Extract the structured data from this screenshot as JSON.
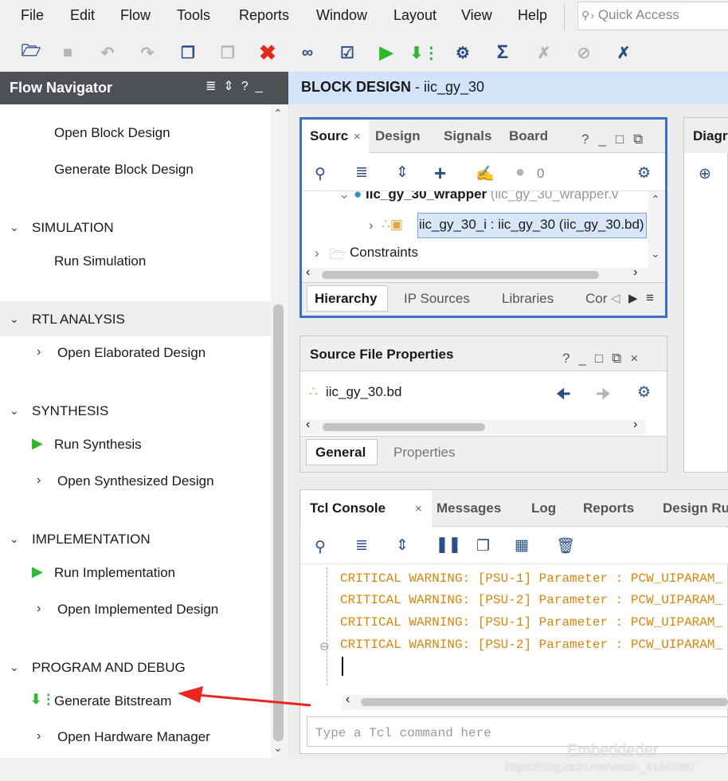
{
  "menu": [
    "File",
    "Edit",
    "Flow",
    "Tools",
    "Reports",
    "Window",
    "Layout",
    "View",
    "Help"
  ],
  "quick_access": {
    "placeholder": "Quick Access",
    "icon": "search-icon"
  },
  "toolbar_icons": [
    "open-project-icon",
    "save-icon",
    "undo-icon",
    "redo-icon",
    "copy-icon",
    "paste-icon",
    "delete-icon",
    "binoculars-icon",
    "checkbox-icon",
    "run-icon",
    "bitstream-icon",
    "settings-icon",
    "sigma-icon",
    "debug-icon",
    "probe-icon",
    "tools-icon"
  ],
  "flow_navigator": {
    "title": "Flow Navigator",
    "items": {
      "open_block_design": "Open Block Design",
      "generate_block_design": "Generate Block Design",
      "simulation": "SIMULATION",
      "run_simulation": "Run Simulation",
      "rtl_analysis": "RTL ANALYSIS",
      "open_elaborated": "Open Elaborated Design",
      "synthesis": "SYNTHESIS",
      "run_synthesis": "Run Synthesis",
      "open_synthesized": "Open Synthesized Design",
      "implementation": "IMPLEMENTATION",
      "run_implementation": "Run Implementation",
      "open_implemented": "Open Implemented Design",
      "program_debug": "PROGRAM AND DEBUG",
      "generate_bitstream": "Generate Bitstream",
      "open_hw_manager": "Open Hardware Manager"
    }
  },
  "block_design": {
    "label": "BLOCK DESIGN",
    "name": " - iic_gy_30"
  },
  "sources": {
    "tabs": [
      "Sourc",
      "Design",
      "Signals",
      "Board"
    ],
    "count": "0",
    "tree": {
      "wrapper": "iic_gy_30_wrapper",
      "wrapper_detail": "(iic_gy_30_wrapper.v",
      "bd_instance": "iic_gy_30_i : iic_gy_30 (iic_gy_30.bd)",
      "constraints": "Constraints"
    },
    "bottom_tabs": [
      "Hierarchy",
      "IP Sources",
      "Libraries",
      "Cor"
    ]
  },
  "diagram_tab": "Diagr",
  "properties": {
    "title": "Source File Properties",
    "file": "iic_gy_30.bd",
    "tabs": [
      "General",
      "Properties"
    ]
  },
  "console": {
    "tabs": [
      "Tcl Console",
      "Messages",
      "Log",
      "Reports",
      "Design Ru"
    ],
    "lines": [
      "CRITICAL WARNING: [PSU-1]  Parameter : PCW_UIPARAM_",
      "CRITICAL WARNING: [PSU-2]  Parameter : PCW_UIPARAM_",
      "CRITICAL WARNING: [PSU-1]  Parameter : PCW_UIPARAM_",
      "CRITICAL WARNING: [PSU-2]  Parameter : PCW_UIPARAM_"
    ],
    "placeholder": "Type a Tcl command here"
  },
  "watermark": {
    "brand": "Embeddeder",
    "url": "https://blog.csdn.net/weixin_41445387"
  },
  "colors": {
    "accent": "#3d6fc9",
    "annotation_arrow": "#e8271e",
    "warning": "#d6860a",
    "run": "#2db82d"
  }
}
